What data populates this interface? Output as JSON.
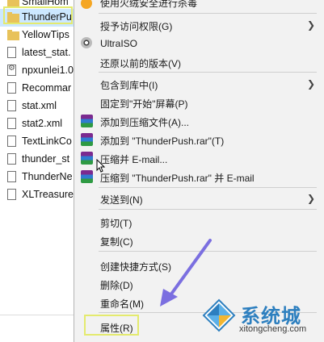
{
  "files": [
    {
      "name": "SmallHom",
      "type": "folder"
    },
    {
      "name": "ThunderPu",
      "type": "folder",
      "selected": true
    },
    {
      "name": "YellowTips",
      "type": "folder"
    },
    {
      "name": "latest_stat.",
      "type": "file"
    },
    {
      "name": "npxunlei1.0",
      "type": "gear"
    },
    {
      "name": "Recommar",
      "type": "file"
    },
    {
      "name": "stat.xml",
      "type": "file"
    },
    {
      "name": "stat2.xml",
      "type": "file"
    },
    {
      "name": "TextLinkCo",
      "type": "file"
    },
    {
      "name": "thunder_st",
      "type": "file"
    },
    {
      "name": "ThunderNe",
      "type": "file"
    },
    {
      "name": "XLTreasure",
      "type": "file"
    }
  ],
  "menu": {
    "top_partial": "使用火绒安全进行杀毒",
    "grant_access": "授予访问权限(G)",
    "ultraiso": "UltraISO",
    "restore_prev": "还原以前的版本(V)",
    "include_library": "包含到库中(I)",
    "pin_start": "固定到\"开始\"屏幕(P)",
    "add_archive": "添加到压缩文件(A)...",
    "add_rar": "添加到 \"ThunderPush.rar\"(T)",
    "compress_email": "压缩并 E-mail...",
    "compress_rar_email": "压缩到 \"ThunderPush.rar\" 并 E-mail",
    "send_to": "发送到(N)",
    "cut": "剪切(T)",
    "copy": "复制(C)",
    "create_shortcut": "创建快捷方式(S)",
    "delete": "删除(D)",
    "rename": "重命名(M)",
    "properties": "属性(R)"
  },
  "watermark": {
    "big": "系统城",
    "small": "xitongcheng.com"
  },
  "colors": {
    "highlight": "#e4ea6e",
    "arrow": "#7b6fe0",
    "menu_bg": "#f2f2f2",
    "selection": "#cce8ff",
    "brand": "#2d7fbf"
  }
}
